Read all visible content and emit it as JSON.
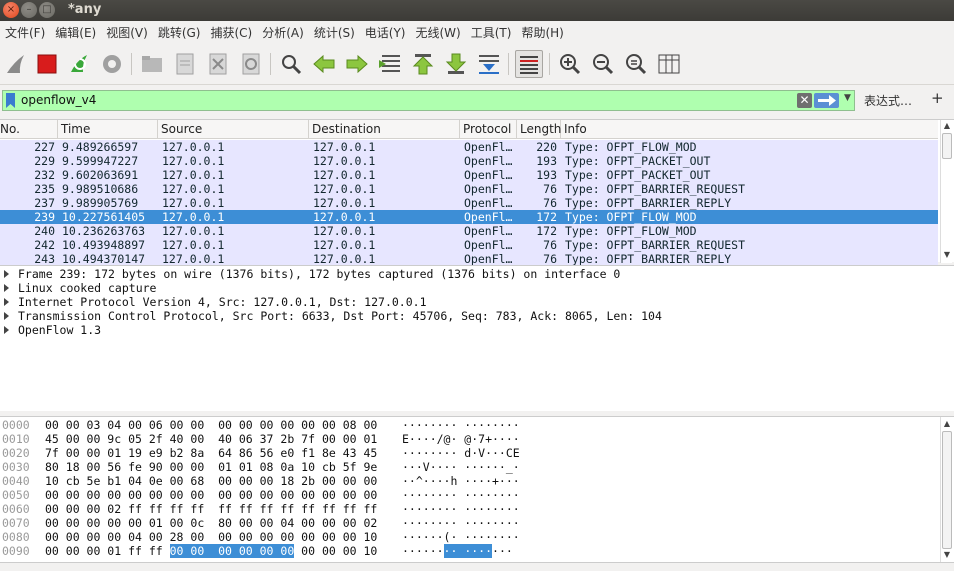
{
  "window": {
    "title": "*any"
  },
  "menu": [
    "文件(F)",
    "编辑(E)",
    "视图(V)",
    "跳转(G)",
    "捕获(C)",
    "分析(A)",
    "统计(S)",
    "电话(Y)",
    "无线(W)",
    "工具(T)",
    "帮助(H)"
  ],
  "toolbar": {
    "icons": [
      "shark-fin-icon",
      "stop-capture-icon",
      "restart-capture-icon",
      "capture-options-icon",
      "open-file-icon",
      "save-file-icon",
      "close-file-icon",
      "reload-file-icon",
      "find-packet-icon",
      "go-back-icon",
      "go-forward-icon",
      "go-to-packet-icon",
      "first-packet-icon",
      "last-packet-icon",
      "auto-scroll-icon",
      "colorize-icon",
      "zoom-in-icon",
      "zoom-out-icon",
      "normal-size-icon",
      "resize-columns-icon"
    ]
  },
  "filter": {
    "value": "openflow_v4",
    "expression_label": "表达式…",
    "plus_label": "+",
    "clear_label": "✕",
    "dropdown_label": "▼"
  },
  "packet_list": {
    "columns": [
      "No.",
      "Time",
      "Source",
      "Destination",
      "Protocol",
      "Length",
      "Info"
    ],
    "rows": [
      {
        "no": "227",
        "time": "9.489266597",
        "src": "127.0.0.1",
        "dst": "127.0.0.1",
        "proto": "OpenFl…",
        "len": "220",
        "info": "Type: OFPT_FLOW_MOD"
      },
      {
        "no": "229",
        "time": "9.599947227",
        "src": "127.0.0.1",
        "dst": "127.0.0.1",
        "proto": "OpenFl…",
        "len": "193",
        "info": "Type: OFPT_PACKET_OUT"
      },
      {
        "no": "232",
        "time": "9.602063691",
        "src": "127.0.0.1",
        "dst": "127.0.0.1",
        "proto": "OpenFl…",
        "len": "193",
        "info": "Type: OFPT_PACKET_OUT"
      },
      {
        "no": "235",
        "time": "9.989510686",
        "src": "127.0.0.1",
        "dst": "127.0.0.1",
        "proto": "OpenFl…",
        "len": "76",
        "info": "Type: OFPT_BARRIER_REQUEST"
      },
      {
        "no": "237",
        "time": "9.989905769",
        "src": "127.0.0.1",
        "dst": "127.0.0.1",
        "proto": "OpenFl…",
        "len": "76",
        "info": "Type: OFPT_BARRIER_REPLY"
      },
      {
        "no": "239",
        "time": "10.227561405",
        "src": "127.0.0.1",
        "dst": "127.0.0.1",
        "proto": "OpenFl…",
        "len": "172",
        "info": "Type: OFPT_FLOW_MOD"
      },
      {
        "no": "240",
        "time": "10.236263763",
        "src": "127.0.0.1",
        "dst": "127.0.0.1",
        "proto": "OpenFl…",
        "len": "172",
        "info": "Type: OFPT_FLOW_MOD"
      },
      {
        "no": "242",
        "time": "10.493948897",
        "src": "127.0.0.1",
        "dst": "127.0.0.1",
        "proto": "OpenFl…",
        "len": "76",
        "info": "Type: OFPT_BARRIER_REQUEST"
      },
      {
        "no": "243",
        "time": "10.494370147",
        "src": "127.0.0.1",
        "dst": "127.0.0.1",
        "proto": "OpenFl…",
        "len": "76",
        "info": "Type: OFPT_BARRIER_REPLY"
      }
    ],
    "selected_no": "239"
  },
  "details": [
    "Frame 239: 172 bytes on wire (1376 bits), 172 bytes captured (1376 bits) on interface 0",
    "Linux cooked capture",
    "Internet Protocol Version 4, Src: 127.0.0.1, Dst: 127.0.0.1",
    "Transmission Control Protocol, Src Port: 6633, Dst Port: 45706, Seq: 783, Ack: 8065, Len: 104",
    "OpenFlow 1.3"
  ],
  "bytes": [
    {
      "off": "0000",
      "hex": "00 00 03 04 00 06 00 00  00 00 00 00 00 00 08 00",
      "ascii": "········ ········"
    },
    {
      "off": "0010",
      "hex": "45 00 00 9c 05 2f 40 00  40 06 37 2b 7f 00 00 01",
      "ascii": "E····/@· @·7+····"
    },
    {
      "off": "0020",
      "hex": "7f 00 00 01 19 e9 b2 8a  64 86 56 e0 f1 8e 43 45",
      "ascii": "········ d·V···CE"
    },
    {
      "off": "0030",
      "hex": "80 18 00 56 fe 90 00 00  01 01 08 0a 10 cb 5f 9e",
      "ascii": "···V···· ······_·"
    },
    {
      "off": "0040",
      "hex": "10 cb 5e b1 04 0e 00 68  00 00 00 18 2b 00 00 00",
      "ascii": "··^····h ····+···"
    },
    {
      "off": "0050",
      "hex": "00 00 00 00 00 00 00 00  00 00 00 00 00 00 00 00",
      "ascii": "········ ········"
    },
    {
      "off": "0060",
      "hex": "00 00 00 02 ff ff ff ff  ff ff ff ff ff ff ff ff",
      "ascii": "········ ········"
    },
    {
      "off": "0070",
      "hex": "00 00 00 00 00 01 00 0c  80 00 00 04 00 00 00 02",
      "ascii": "········ ········"
    },
    {
      "off": "0080",
      "hex": "00 00 00 00 04 00 28 00  00 00 00 00 00 00 00 10",
      "ascii": "······(· ········"
    },
    {
      "off": "0090",
      "hex_pre": "00 00 00 01 ff ff ",
      "hex_hl": "00 00  00 00 00 00",
      "hex_post": " 00 00 00 10",
      "ascii_pre": "······",
      "ascii_hl": "·· ····",
      "ascii_post": "···"
    }
  ]
}
